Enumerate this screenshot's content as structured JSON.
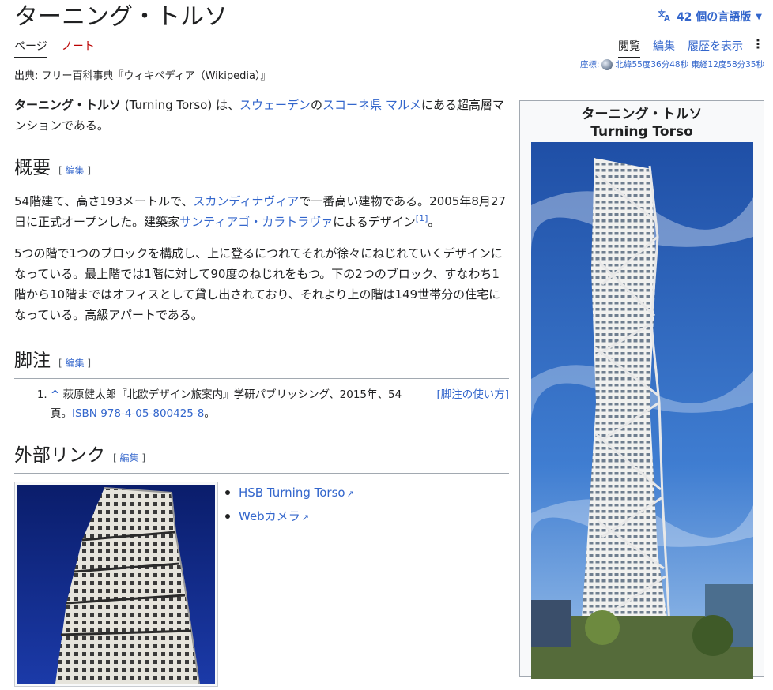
{
  "page": {
    "title": "ターニング・トルソ",
    "lang_button": "42 個の言語版",
    "tabs_left": [
      "ページ",
      "ノート"
    ],
    "tabs_right": [
      "閲覧",
      "編集",
      "履歴を表示"
    ],
    "coords": {
      "label": "座標:",
      "value": "北緯55度36分48秒 東経12度58分35秒"
    },
    "source": "出典: フリー百科事典『ウィキペディア（Wikipedia）』"
  },
  "lead": {
    "bold": "ターニング・トルソ",
    "t1": " (Turning Torso) は、",
    "link1": "スウェーデン",
    "t2": "の",
    "link2": "スコーネ県",
    "t3": " ",
    "link3": "マルメ",
    "t4": "にある超高層マンションである。"
  },
  "sections": {
    "overview": {
      "heading": "概要",
      "edit": "編集",
      "p1": {
        "t1": "54階建て、高さ193メートルで、",
        "link1": "スカンディナヴィア",
        "t2": "で一番高い建物である。2005年8月27日に正式オープンした。建築家",
        "link2": "サンティアゴ・カラトラヴァ",
        "t3": "によるデザイン",
        "ref": "[1]",
        "t4": "。"
      },
      "p2": "5つの階で1つのブロックを構成し、上に登るにつれてそれが徐々にねじれていくデザインになっている。最上階では1階に対して90度のねじれをもつ。下の2つのブロック、すなわち1階から10階まではオフィスとして貸し出されており、それより上の階は149世帯分の住宅になっている。高級アパートである。"
    },
    "notes": {
      "heading": "脚注",
      "edit": "編集",
      "howto": "[脚注の使い方]",
      "ref1": {
        "caret": "^",
        "text": " 萩原健太郎『北欧デザイン旅案内』学研パブリッシング、2015年、54頁。",
        "isbn": "ISBN 978-4-05-800425-8",
        "end": "。"
      }
    },
    "external": {
      "heading": "外部リンク",
      "edit": "編集",
      "links": [
        "HSB Turning Torso",
        "Webカメラ"
      ]
    }
  },
  "infobox": {
    "title_ja": "ターニング・トルソ",
    "title_en": "Turning Torso"
  },
  "colors": {
    "link": "#3366cc",
    "text": "#202122",
    "border": "#a2a9b1",
    "note_red": "#ba0000"
  }
}
